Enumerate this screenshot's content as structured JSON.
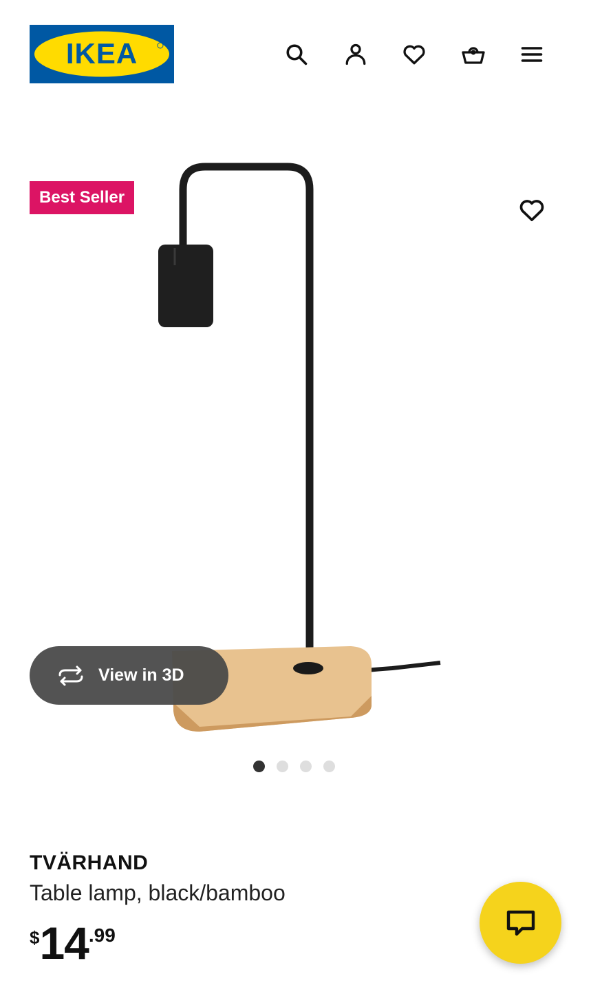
{
  "header": {
    "logo_text": "IKEA",
    "icons": [
      "search-icon",
      "account-icon",
      "heart-icon",
      "basket-icon",
      "menu-icon"
    ]
  },
  "gallery": {
    "badge": "Best Seller",
    "view_in_3d": "View in 3D",
    "image_count": 4,
    "active_index": 0
  },
  "product": {
    "name": "TVÄRHAND",
    "description": "Table lamp, black/bamboo",
    "price": {
      "currency": "$",
      "integer": "14",
      "decimal": ".99"
    }
  },
  "colors": {
    "ikea_blue": "#0058a3",
    "ikea_yellow": "#ffdb00",
    "badge_red": "#dc1464",
    "chat_yellow": "#f5d31c"
  }
}
